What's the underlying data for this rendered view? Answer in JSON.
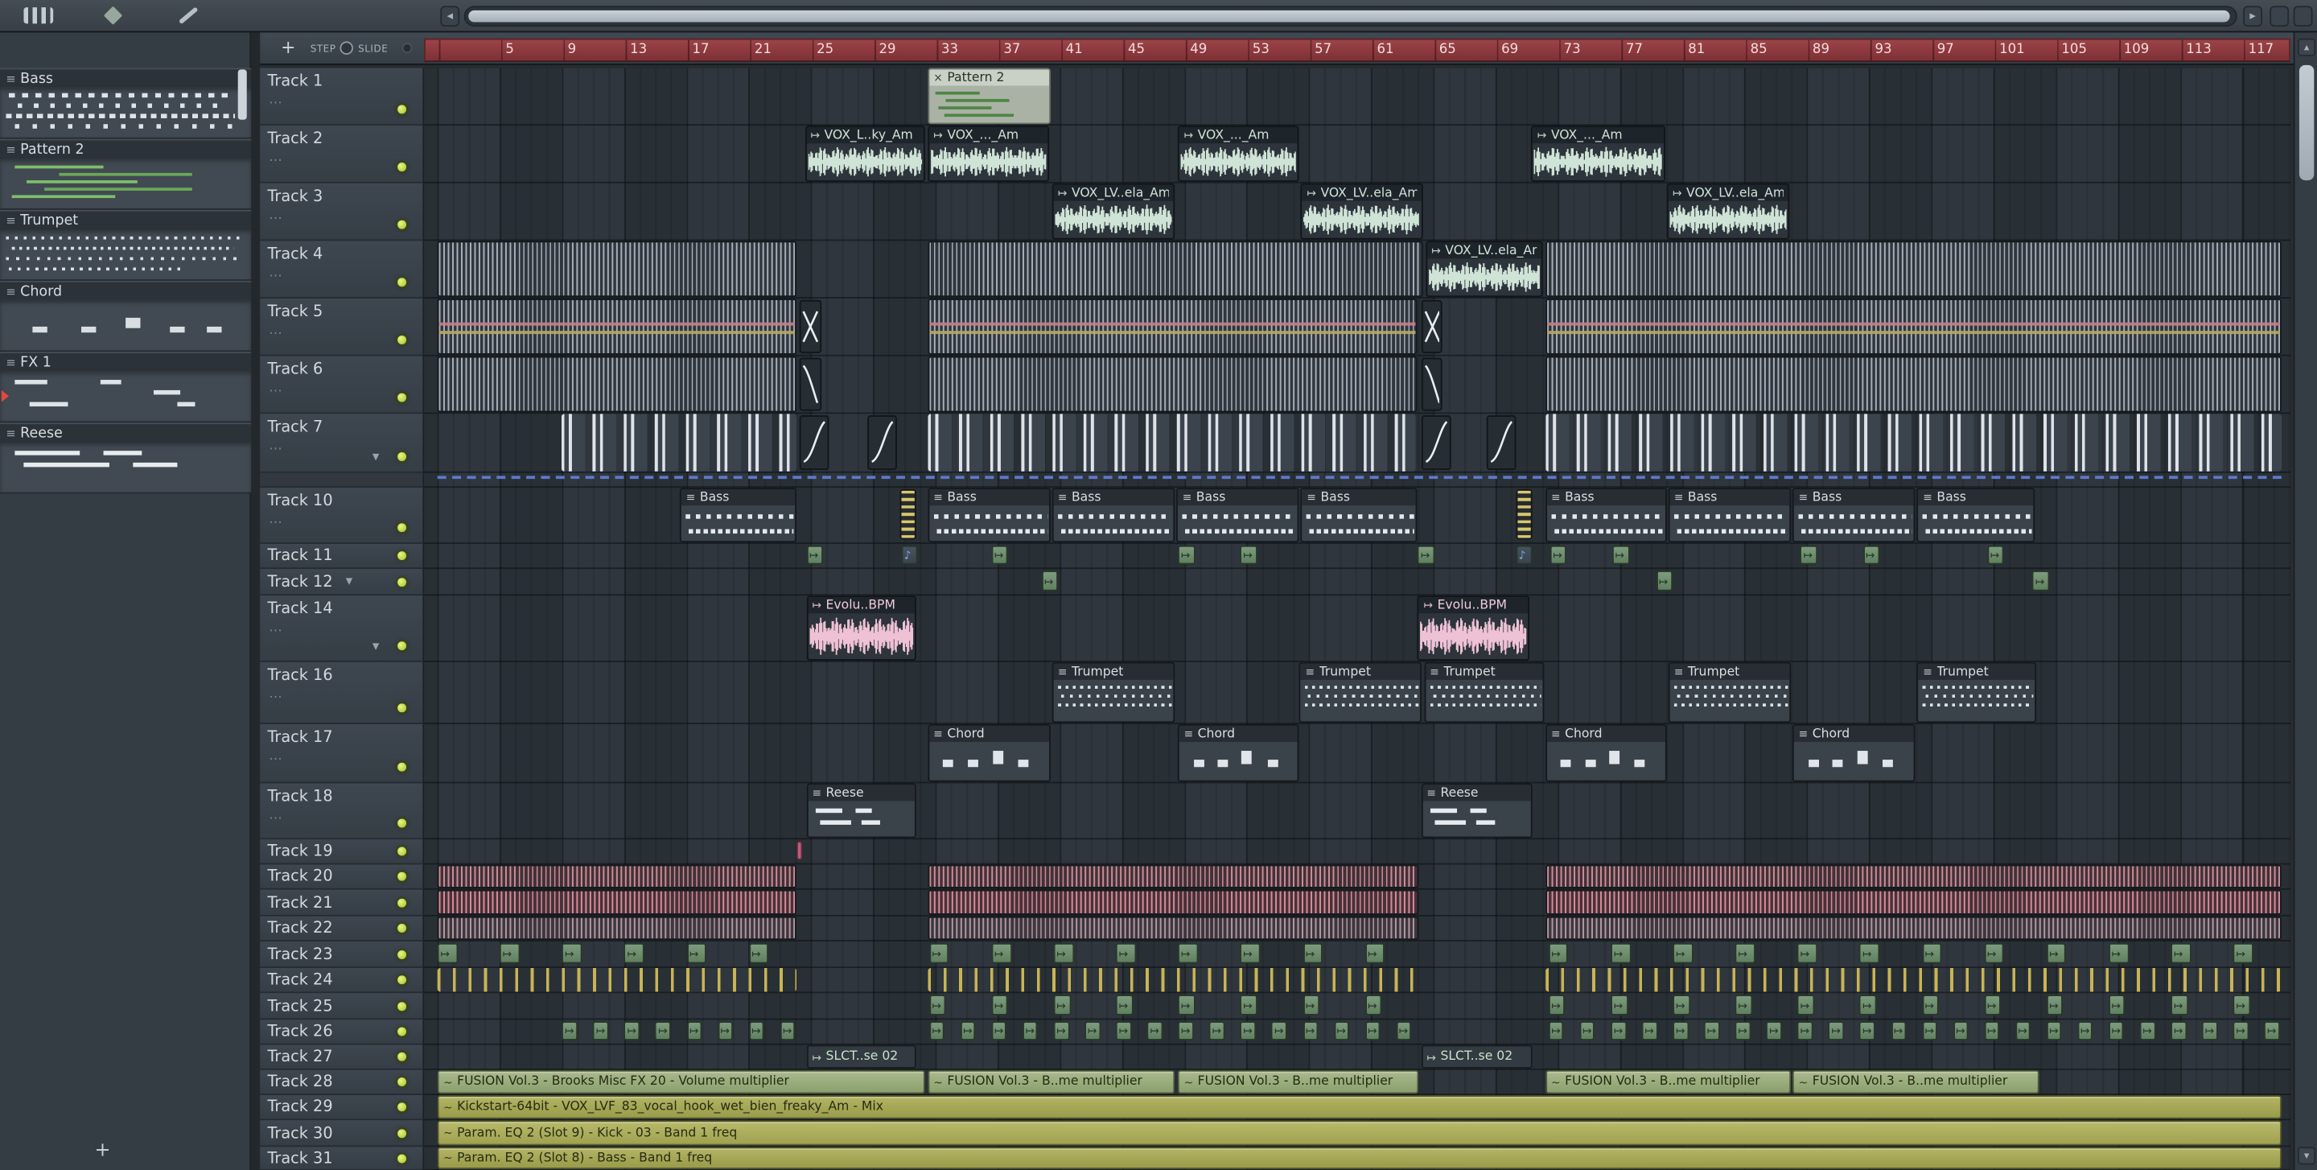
{
  "pl_toolbar": {
    "add_label": "+",
    "step_label": "STEP",
    "slide_label": "SLIDE"
  },
  "timeline": {
    "numbers": [
      5,
      9,
      13,
      17,
      21,
      25,
      29,
      33,
      37,
      41,
      45,
      49,
      53,
      57,
      61,
      65,
      69,
      73,
      77,
      81,
      85,
      89,
      93,
      97,
      101,
      105,
      109,
      113,
      117
    ]
  },
  "icons": {
    "pattern_clip": "≡",
    "audio_clip": "↦",
    "automation_clip": "~",
    "selected_clip": "×",
    "midi_clip": "♪",
    "collapse": "▼",
    "sub": "…"
  },
  "pattern_picker": {
    "add_label": "+",
    "patterns": [
      {
        "name": "Bass",
        "preview": "bass"
      },
      {
        "name": "Pattern 2",
        "preview": "piano"
      },
      {
        "name": "Trumpet",
        "preview": "trumpet"
      },
      {
        "name": "Chord",
        "preview": "chord"
      },
      {
        "name": "FX 1",
        "preview": "fx1",
        "playing": true
      },
      {
        "name": "Reese",
        "preview": "reese"
      }
    ]
  },
  "tracks": [
    {
      "name": "Track 1",
      "h": 39,
      "size": "large"
    },
    {
      "name": "Track 2",
      "h": 39,
      "size": "large"
    },
    {
      "name": "Track 3",
      "h": 39,
      "size": "large"
    },
    {
      "name": "Track 4",
      "h": 39,
      "size": "large"
    },
    {
      "name": "Track 5",
      "h": 39,
      "size": "large"
    },
    {
      "name": "Track 6",
      "h": 39,
      "size": "large"
    },
    {
      "name": "Track 7",
      "h": 40,
      "size": "large",
      "arrow": true
    },
    {
      "name": "",
      "h": 10,
      "size": "spacer"
    },
    {
      "name": "Track 10",
      "h": 38,
      "size": "large"
    },
    {
      "name": "Track 11",
      "h": 17,
      "size": "small"
    },
    {
      "name": "Track 12",
      "h": 18,
      "size": "small",
      "arrow": true
    },
    {
      "name": "Track 14",
      "h": 45,
      "size": "large",
      "arrow": true
    },
    {
      "name": "Track 16",
      "h": 42,
      "size": "large"
    },
    {
      "name": "Track 17",
      "h": 40,
      "size": "large"
    },
    {
      "name": "Track 18",
      "h": 38,
      "size": "large"
    },
    {
      "name": "Track 19",
      "h": 17,
      "size": "small"
    },
    {
      "name": "Track 20",
      "h": 17,
      "size": "small"
    },
    {
      "name": "Track 21",
      "h": 18,
      "size": "small"
    },
    {
      "name": "Track 22",
      "h": 17,
      "size": "small"
    },
    {
      "name": "Track 23",
      "h": 18,
      "size": "small"
    },
    {
      "name": "Track 24",
      "h": 17,
      "size": "small"
    },
    {
      "name": "Track 25",
      "h": 18,
      "size": "small"
    },
    {
      "name": "Track 26",
      "h": 17,
      "size": "small"
    },
    {
      "name": "Track 27",
      "h": 17,
      "size": "small"
    },
    {
      "name": "Track 28",
      "h": 17,
      "size": "small"
    },
    {
      "name": "Track 29",
      "h": 17,
      "size": "small"
    },
    {
      "name": "Track 30",
      "h": 18,
      "size": "small"
    },
    {
      "name": "Track 31",
      "h": 16,
      "size": "small"
    }
  ],
  "clips": [
    {
      "t": 0,
      "s": 32.5,
      "e": 40.5,
      "type": "pattern-sel",
      "label": "Pattern 2",
      "body": "piano"
    },
    {
      "t": 1,
      "s": 24.6,
      "e": 32.4,
      "type": "audio",
      "label": "VOX_L..ky_Am"
    },
    {
      "t": 1,
      "s": 32.5,
      "e": 40.4,
      "type": "audio",
      "label": "VOX_..._Am"
    },
    {
      "t": 1,
      "s": 48.6,
      "e": 56.5,
      "type": "audio",
      "label": "VOX_..._Am"
    },
    {
      "t": 1,
      "s": 71.3,
      "e": 80.0,
      "type": "audio",
      "label": "VOX_..._Am"
    },
    {
      "t": 2,
      "s": 40.5,
      "e": 48.5,
      "type": "audio",
      "label": "VOX_LV..ela_Am"
    },
    {
      "t": 2,
      "s": 56.5,
      "e": 64.4,
      "type": "audio",
      "label": "VOX_LV..ela_Am"
    },
    {
      "t": 2,
      "s": 80.0,
      "e": 88.0,
      "type": "audio",
      "label": "VOX_LV..ela_Am"
    },
    {
      "t": 3,
      "s": 1,
      "e": 24.2,
      "type": "stripes",
      "v": "a"
    },
    {
      "t": 3,
      "s": 32.5,
      "e": 64.4,
      "type": "stripes",
      "v": "a"
    },
    {
      "t": 3,
      "s": 64.5,
      "e": 72.1,
      "type": "audio",
      "label": "VOX_LV..ela_Am"
    },
    {
      "t": 3,
      "s": 72.2,
      "e": 119.6,
      "type": "stripes",
      "v": "a"
    },
    {
      "t": 4,
      "s": 1,
      "e": 24.2,
      "type": "stripes",
      "v": "b"
    },
    {
      "t": 4,
      "s": 24.3,
      "e": 25.8,
      "type": "sweep",
      "v": "x"
    },
    {
      "t": 4,
      "s": 32.5,
      "e": 64.1,
      "type": "stripes",
      "v": "b"
    },
    {
      "t": 4,
      "s": 64.2,
      "e": 65.7,
      "type": "sweep",
      "v": "x"
    },
    {
      "t": 4,
      "s": 72.2,
      "e": 119.6,
      "type": "stripes",
      "v": "b"
    },
    {
      "t": 5,
      "s": 1,
      "e": 24.2,
      "type": "stripes",
      "v": "a"
    },
    {
      "t": 5,
      "s": 24.3,
      "e": 25.8,
      "type": "sweep",
      "v": "down"
    },
    {
      "t": 5,
      "s": 32.5,
      "e": 64.1,
      "type": "stripes",
      "v": "a"
    },
    {
      "t": 5,
      "s": 64.2,
      "e": 65.7,
      "type": "sweep",
      "v": "down"
    },
    {
      "t": 5,
      "s": 72.2,
      "e": 119.6,
      "type": "stripes",
      "v": "a"
    },
    {
      "t": 6,
      "s": 9,
      "e": 24.2,
      "type": "hats"
    },
    {
      "t": 6,
      "s": 24.3,
      "e": 26.3,
      "type": "sweep",
      "v": "up"
    },
    {
      "t": 6,
      "s": 28.6,
      "e": 30.6,
      "type": "sweep",
      "v": "up"
    },
    {
      "t": 6,
      "s": 32.5,
      "e": 64.0,
      "type": "hats"
    },
    {
      "t": 6,
      "s": 64.2,
      "e": 66.2,
      "type": "sweep",
      "v": "up"
    },
    {
      "t": 6,
      "s": 68.4,
      "e": 70.4,
      "type": "sweep",
      "v": "up"
    },
    {
      "t": 6,
      "s": 72.2,
      "e": 119.6,
      "type": "hats"
    },
    {
      "t": 7,
      "s": 1,
      "e": 119.6,
      "type": "dashed"
    },
    {
      "t": 8,
      "s": 16.6,
      "e": 24.2,
      "type": "pattern",
      "label": "Bass",
      "body": "bass"
    },
    {
      "t": 8,
      "s": 30.7,
      "e": 31.9,
      "type": "fill"
    },
    {
      "t": 8,
      "s": 32.5,
      "e": 40.5,
      "type": "pattern",
      "label": "Bass",
      "body": "bass"
    },
    {
      "t": 8,
      "s": 40.5,
      "e": 48.5,
      "type": "pattern",
      "label": "Bass",
      "body": "bass"
    },
    {
      "t": 8,
      "s": 48.5,
      "e": 56.5,
      "type": "pattern",
      "label": "Bass",
      "body": "bass"
    },
    {
      "t": 8,
      "s": 56.5,
      "e": 64.1,
      "type": "pattern",
      "label": "Bass",
      "body": "bass"
    },
    {
      "t": 8,
      "s": 70.3,
      "e": 71.5,
      "type": "fill"
    },
    {
      "t": 8,
      "s": 72.2,
      "e": 80.1,
      "type": "pattern",
      "label": "Bass",
      "body": "bass"
    },
    {
      "t": 8,
      "s": 80.1,
      "e": 88.1,
      "type": "pattern",
      "label": "Bass",
      "body": "bass"
    },
    {
      "t": 8,
      "s": 88.1,
      "e": 96.1,
      "type": "pattern",
      "label": "Bass",
      "body": "bass"
    },
    {
      "t": 8,
      "s": 96.1,
      "e": 103.8,
      "type": "pattern",
      "label": "Bass",
      "body": "bass"
    },
    {
      "t": 9,
      "s": 24.7,
      "w": 1.2,
      "type": "mini"
    },
    {
      "t": 9,
      "s": 30.8,
      "w": 1.2,
      "type": "mini",
      "v": "blue"
    },
    {
      "t": 9,
      "s": 36.6,
      "w": 1.2,
      "type": "mini"
    },
    {
      "t": 9,
      "s": 48.6,
      "w": 1.2,
      "type": "mini"
    },
    {
      "t": 9,
      "s": 52.6,
      "w": 1.2,
      "type": "mini"
    },
    {
      "t": 9,
      "s": 64.0,
      "w": 1.2,
      "type": "mini"
    },
    {
      "t": 9,
      "s": 70.3,
      "w": 1.2,
      "type": "mini",
      "v": "blue"
    },
    {
      "t": 9,
      "s": 72.5,
      "w": 1.2,
      "type": "mini"
    },
    {
      "t": 9,
      "s": 76.5,
      "w": 1.2,
      "type": "mini"
    },
    {
      "t": 9,
      "s": 88.6,
      "w": 1.2,
      "type": "mini"
    },
    {
      "t": 9,
      "s": 92.6,
      "w": 1.2,
      "type": "mini"
    },
    {
      "t": 9,
      "s": 100.6,
      "w": 1.2,
      "type": "mini"
    },
    {
      "t": 10,
      "s": 39.8,
      "w": 1.2,
      "type": "mini"
    },
    {
      "t": 10,
      "s": 79.3,
      "w": 1.2,
      "type": "mini"
    },
    {
      "t": 10,
      "s": 103.5,
      "w": 1.2,
      "type": "mini"
    },
    {
      "t": 11,
      "s": 24.7,
      "e": 31.9,
      "type": "audio",
      "label": "Evolu..BPM",
      "wave": "pink"
    },
    {
      "t": 11,
      "s": 64.0,
      "e": 71.3,
      "type": "audio",
      "label": "Evolu..BPM",
      "wave": "pink"
    },
    {
      "t": 12,
      "s": 40.5,
      "e": 48.5,
      "type": "pattern",
      "label": "Trumpet",
      "body": "trumpet"
    },
    {
      "t": 12,
      "s": 56.4,
      "e": 64.3,
      "type": "pattern",
      "label": "Trumpet",
      "body": "trumpet"
    },
    {
      "t": 12,
      "s": 64.4,
      "e": 72.2,
      "type": "pattern",
      "label": "Trumpet",
      "body": "trumpet"
    },
    {
      "t": 12,
      "s": 80.1,
      "e": 88.1,
      "type": "pattern",
      "label": "Trumpet",
      "body": "trumpet"
    },
    {
      "t": 12,
      "s": 96.1,
      "e": 103.9,
      "type": "pattern",
      "label": "Trumpet",
      "body": "trumpet"
    },
    {
      "t": 13,
      "s": 32.5,
      "e": 40.5,
      "type": "pattern",
      "label": "Chord",
      "body": "chord"
    },
    {
      "t": 13,
      "s": 48.6,
      "e": 56.5,
      "type": "pattern",
      "label": "Chord",
      "body": "chord"
    },
    {
      "t": 13,
      "s": 72.2,
      "e": 80.1,
      "type": "pattern",
      "label": "Chord",
      "body": "chord"
    },
    {
      "t": 13,
      "s": 88.1,
      "e": 96.1,
      "type": "pattern",
      "label": "Chord",
      "body": "chord"
    },
    {
      "t": 14,
      "s": 24.7,
      "e": 31.9,
      "type": "pattern",
      "label": "Reese",
      "body": "reese"
    },
    {
      "t": 14,
      "s": 64.2,
      "e": 71.5,
      "type": "pattern",
      "label": "Reese",
      "body": "reese"
    },
    {
      "t": 15,
      "s": 24.1,
      "w": 0.45,
      "type": "mini",
      "v": "pink"
    },
    {
      "t": 16,
      "s": 1,
      "e": 24.2,
      "type": "stripes",
      "v": "p1"
    },
    {
      "t": 16,
      "s": 32.5,
      "e": 64.2,
      "type": "stripes",
      "v": "p1"
    },
    {
      "t": 16,
      "s": 72.2,
      "e": 119.6,
      "type": "stripes",
      "v": "p1"
    },
    {
      "t": 17,
      "s": 1,
      "e": 24.2,
      "type": "stripes",
      "v": "p2"
    },
    {
      "t": 17,
      "s": 32.5,
      "e": 64.2,
      "type": "stripes",
      "v": "p2"
    },
    {
      "t": 17,
      "s": 72.2,
      "e": 119.6,
      "type": "stripes",
      "v": "p2"
    },
    {
      "t": 18,
      "s": 1,
      "e": 24.2,
      "type": "stripes",
      "v": "p3"
    },
    {
      "t": 18,
      "s": 32.5,
      "e": 64.2,
      "type": "stripes",
      "v": "p3"
    },
    {
      "t": 18,
      "s": 72.2,
      "e": 119.6,
      "type": "stripes",
      "v": "p3"
    },
    {
      "t": 19,
      "s": 1,
      "step": 4,
      "n": 6,
      "w": 1.4,
      "type": "mini"
    },
    {
      "t": 19,
      "s": 32.6,
      "step": 4,
      "n": 8,
      "w": 1.4,
      "type": "mini"
    },
    {
      "t": 19,
      "s": 72.4,
      "step": 4,
      "n": 12,
      "w": 1.4,
      "type": "mini"
    },
    {
      "t": 20,
      "s": 1,
      "e": 24.2,
      "type": "ticks"
    },
    {
      "t": 20,
      "s": 32.5,
      "e": 64.2,
      "type": "ticks"
    },
    {
      "t": 20,
      "s": 72.2,
      "e": 119.6,
      "type": "ticks"
    },
    {
      "t": 21,
      "s": 32.6,
      "step": 4,
      "n": 8,
      "w": 1.2,
      "type": "mini"
    },
    {
      "t": 21,
      "s": 72.4,
      "step": 4,
      "n": 12,
      "w": 1.2,
      "type": "mini"
    },
    {
      "t": 22,
      "s": 9,
      "step": 2,
      "n": 8,
      "w": 1.1,
      "type": "mini"
    },
    {
      "t": 22,
      "s": 32.6,
      "step": 2,
      "n": 16,
      "w": 1.1,
      "type": "mini"
    },
    {
      "t": 22,
      "s": 72.4,
      "step": 2,
      "n": 24,
      "w": 1.1,
      "type": "mini"
    },
    {
      "t": 23,
      "s": 24.7,
      "e": 31.9,
      "type": "slct",
      "label": "SLCT..se 02"
    },
    {
      "t": 23,
      "s": 64.2,
      "e": 71.5,
      "type": "slct",
      "label": "SLCT..se 02"
    },
    {
      "t": 24,
      "s": 1,
      "e": 32.4,
      "type": "auto",
      "v": "sage",
      "label": "FUSION Vol.3 - Brooks Misc FX 20 - Volume multiplier"
    },
    {
      "t": 24,
      "s": 32.5,
      "e": 48.5,
      "type": "auto",
      "v": "sage",
      "label": "FUSION Vol.3 - B..me multiplier"
    },
    {
      "t": 24,
      "s": 48.6,
      "e": 64.2,
      "type": "auto",
      "v": "sage",
      "label": "FUSION Vol.3 - B..me multiplier"
    },
    {
      "t": 24,
      "s": 72.2,
      "e": 88.1,
      "type": "auto",
      "v": "sage",
      "label": "FUSION Vol.3 - B..me multiplier"
    },
    {
      "t": 24,
      "s": 88.1,
      "e": 104.0,
      "type": "auto",
      "v": "sage",
      "label": "FUSION Vol.3 - B..me multiplier"
    },
    {
      "t": 25,
      "s": 1,
      "e": 119.6,
      "type": "auto",
      "v": "olive",
      "label": "Kickstart-64bit - VOX_LVF_83_vocal_hook_wet_bien_freaky_Am - Mix"
    },
    {
      "t": 26,
      "s": 1,
      "e": 119.6,
      "type": "auto",
      "v": "olive2",
      "label": "Param. EQ 2 (Slot 9) - Kick - 03 - Band 1 freq"
    },
    {
      "t": 27,
      "s": 1,
      "e": 119.6,
      "type": "auto",
      "v": "olive",
      "label": "Param. EQ 2 (Slot 8) - Bass - Band 1 freq"
    }
  ]
}
